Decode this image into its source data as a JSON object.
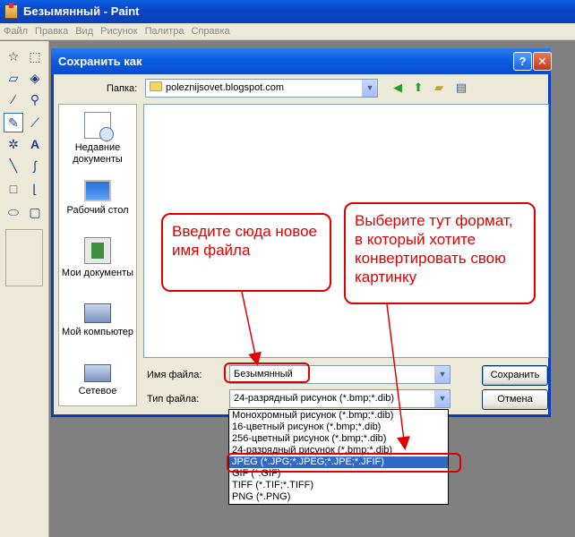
{
  "app": {
    "title": "Безымянный - Paint",
    "menu": [
      "Файл",
      "Правка",
      "Вид",
      "Рисунок",
      "Палитра",
      "Справка"
    ]
  },
  "tools": [
    "free-select",
    "rect-select",
    "eraser",
    "fill",
    "color-picker",
    "magnifier",
    "pencil",
    "brush",
    "airbrush",
    "text",
    "line",
    "curve",
    "rectangle",
    "polygon",
    "ellipse",
    "rounded-rect"
  ],
  "dialog": {
    "title": "Сохранить как",
    "help_label": "?",
    "close_label": "✕",
    "folder_label": "Папка:",
    "folder_value": "poleznijsovet.blogspot.com",
    "places": [
      {
        "label": "Недавние документы",
        "icon": "recent-documents-icon"
      },
      {
        "label": "Рабочий стол",
        "icon": "desktop-icon"
      },
      {
        "label": "Мои документы",
        "icon": "my-documents-icon"
      },
      {
        "label": "Мой компьютер",
        "icon": "my-computer-icon"
      },
      {
        "label": "Сетевое",
        "icon": "network-icon"
      }
    ],
    "filename_label": "Имя файла:",
    "filename_value": "Безымянный",
    "filetype_label": "Тип файла:",
    "filetype_value": "24-разрядный рисунок (*.bmp;*.dib)",
    "save_label": "Сохранить",
    "cancel_label": "Отмена"
  },
  "filetype_options": [
    "Монохромный рисунок (*.bmp;*.dib)",
    "16-цветный рисунок (*.bmp;*.dib)",
    "256-цветный рисунок (*.bmp;*.dib)",
    "24-разрядный рисунок (*.bmp;*.dib)",
    "JPEG (*.JPG;*.JPEG;*.JPE;*.JFIF)",
    "GIF (*.GIF)",
    "TIFF (*.TIF;*.TIFF)",
    "PNG (*.PNG)"
  ],
  "selected_option": 4,
  "callouts": {
    "filename": "Введите сюда новое имя файла",
    "format": "Выберите тут формат, в который хотите конвертировать свою картинку"
  },
  "colors": {
    "annotation": "#e00000",
    "selection": "#316ac5",
    "titlebar": "#0a5ee0"
  }
}
